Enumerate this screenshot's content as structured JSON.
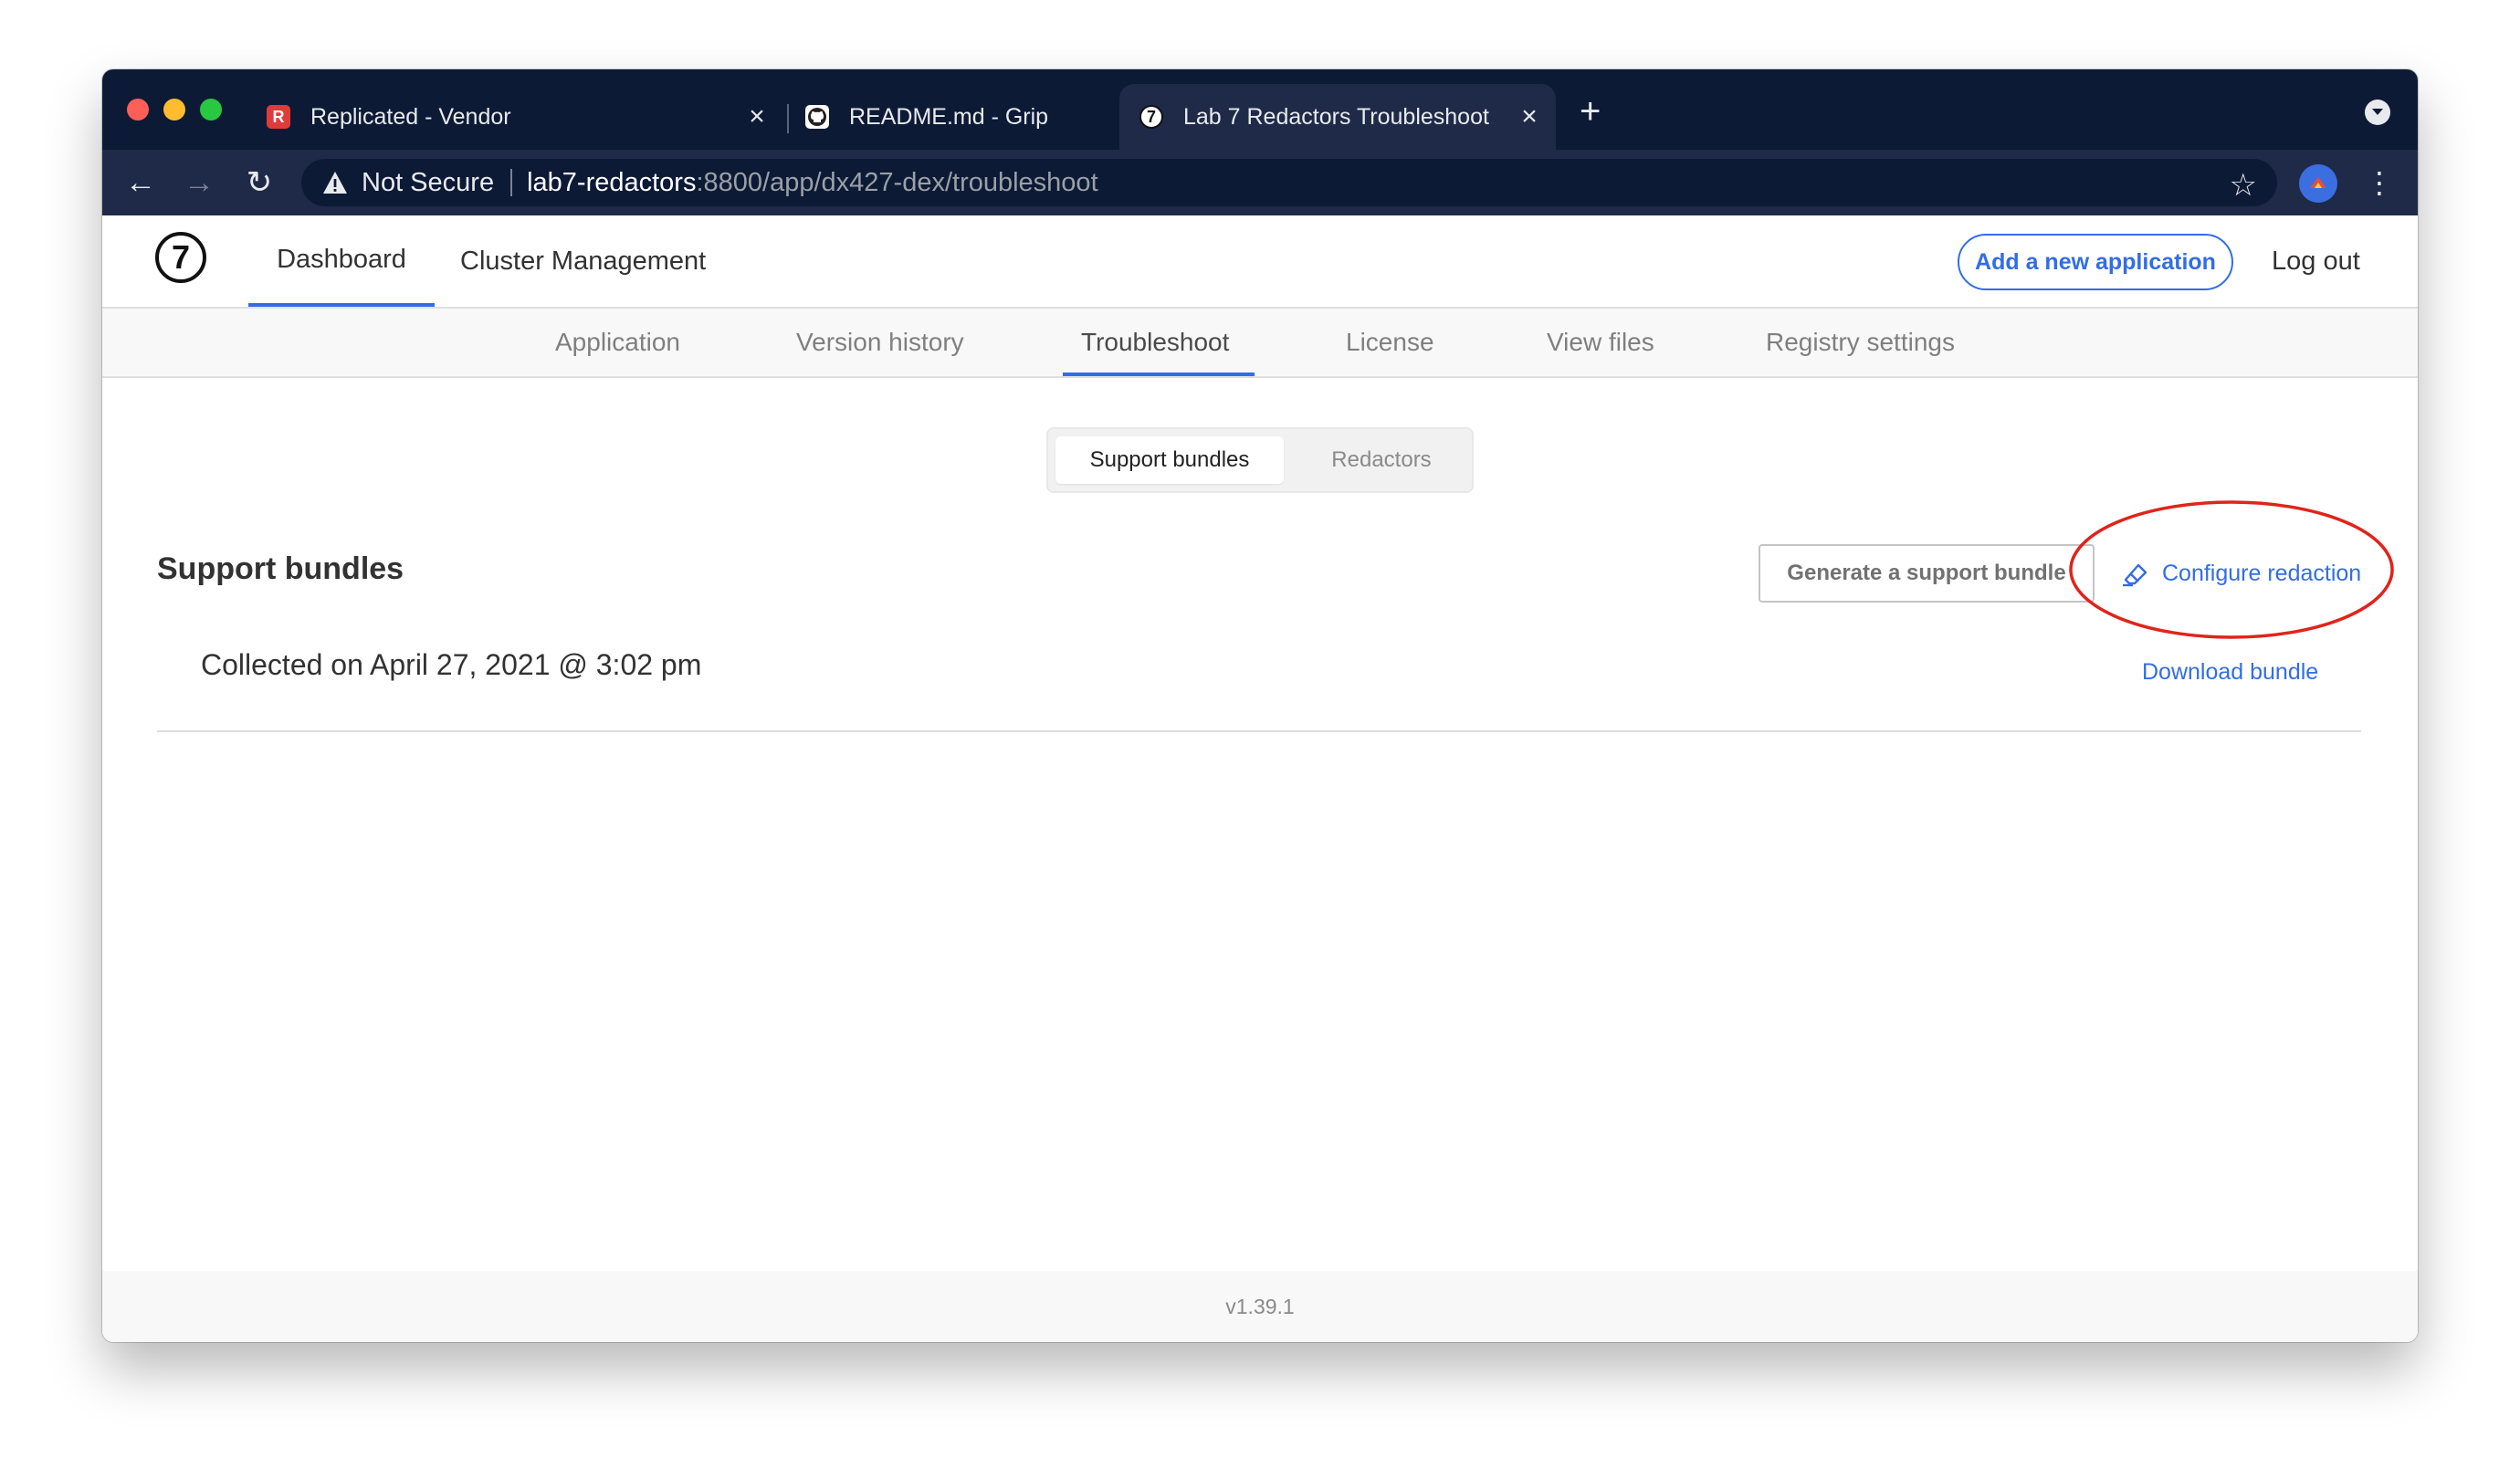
{
  "browser": {
    "tabs": [
      {
        "title": "Replicated - Vendor",
        "favicon": "replicated-logo-icon",
        "favicon_text": "R",
        "favicon_color": "#e03b3b"
      },
      {
        "title": "README.md - Grip",
        "favicon": "github-icon",
        "favicon_text": "",
        "favicon_color": "#ffffff"
      },
      {
        "title": "Lab 7 Redactors Troubleshoot",
        "favicon": "app-seven-icon",
        "favicon_text": "7",
        "favicon_color": "#ffffff",
        "active": true
      }
    ],
    "omnibox": {
      "security_label": "Not Secure",
      "host": "lab7-redactors",
      "path": ":8800/app/dx427-dex/troubleshoot"
    }
  },
  "header": {
    "logo_text": "7",
    "nav": [
      {
        "label": "Dashboard",
        "active": true
      },
      {
        "label": "Cluster Management",
        "active": false
      }
    ],
    "add_app_label": "Add a new application",
    "logout_label": "Log out"
  },
  "subnav": {
    "tabs": [
      {
        "label": "Application"
      },
      {
        "label": "Version history"
      },
      {
        "label": "Troubleshoot",
        "active": true
      },
      {
        "label": "License"
      },
      {
        "label": "View files"
      },
      {
        "label": "Registry settings"
      }
    ]
  },
  "content": {
    "toggle": {
      "options": [
        "Support bundles",
        "Redactors"
      ],
      "selected": "Support bundles"
    },
    "section_title": "Support bundles",
    "generate_label": "Generate a support bundle",
    "configure_label": "Configure redaction",
    "bundles": [
      {
        "collected": "Collected on April 27, 2021 @ 3:02 pm",
        "download_label": "Download bundle"
      }
    ]
  },
  "footer": {
    "version": "v1.39.1"
  },
  "colors": {
    "accent": "#326de6",
    "annotation": "#e0241b",
    "chrome_dark": "#0d1a36",
    "chrome_toolbar": "#1e2a48"
  }
}
